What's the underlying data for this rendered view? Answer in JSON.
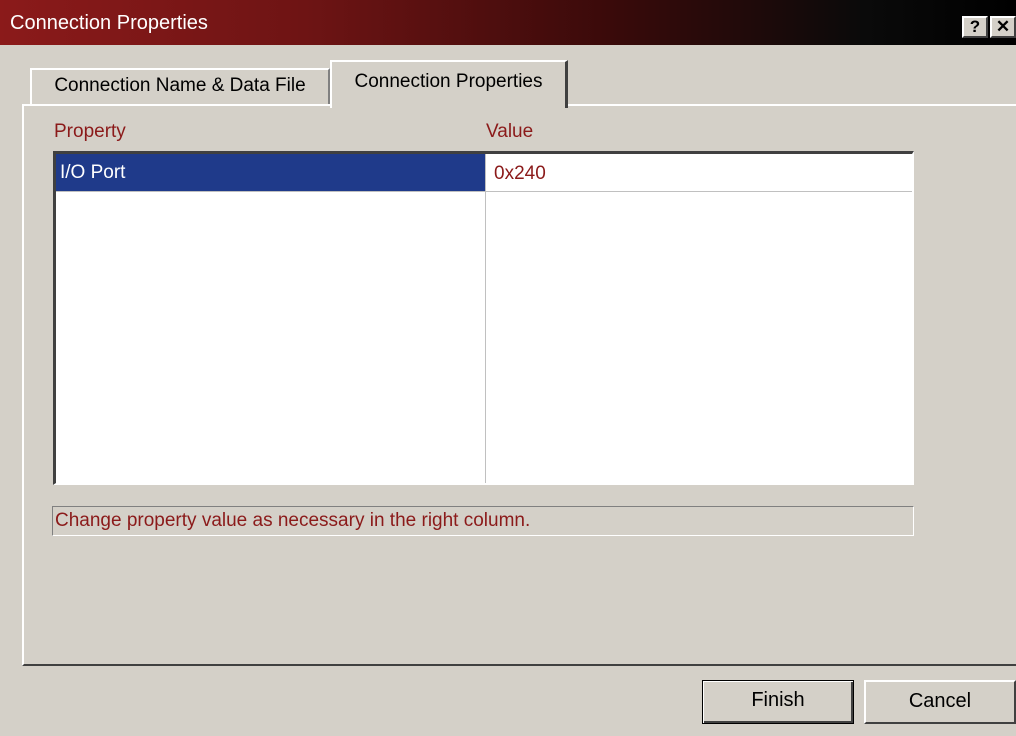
{
  "window": {
    "title": "Connection Properties",
    "help_glyph": "?",
    "close_glyph": "✕"
  },
  "tabs": [
    {
      "label": "Connection Name & Data File",
      "active": false
    },
    {
      "label": "Connection Properties",
      "active": true
    }
  ],
  "grid": {
    "headers": {
      "property": "Property",
      "value": "Value"
    },
    "rows": [
      {
        "property": "I/O Port",
        "value": "0x240",
        "selected": true
      }
    ]
  },
  "status_text": "Change property value as necessary in the right column.",
  "buttons": {
    "finish": "Finish",
    "cancel": "Cancel"
  },
  "colors": {
    "title_gradient_start": "#8b1a1a",
    "title_gradient_end": "#000000",
    "selection": "#1f3a8a",
    "accent_text": "#8b1a1a",
    "face": "#d4d0c8"
  }
}
